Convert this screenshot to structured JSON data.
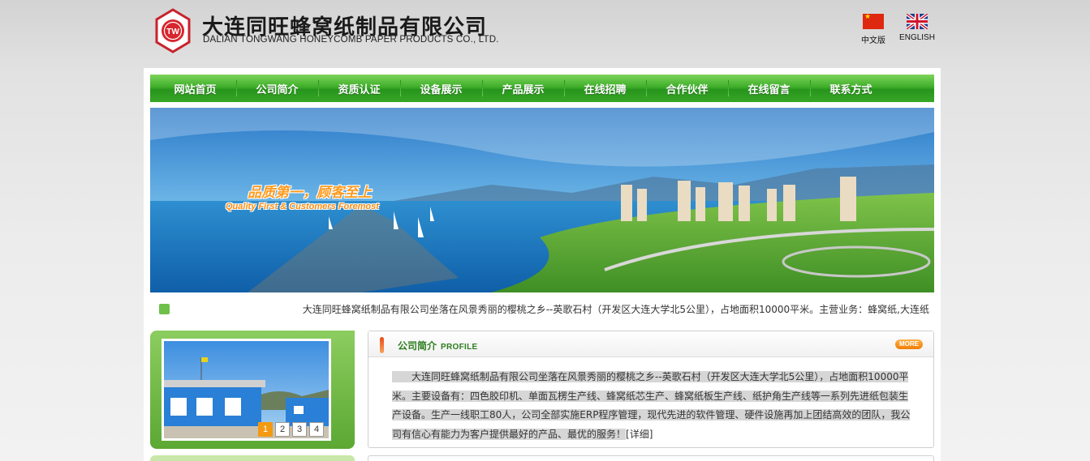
{
  "header": {
    "logo_badge_text": "TW",
    "company_name_cn": "大连同旺蜂窝纸制品有限公司",
    "company_name_en": "DALIAN TONGWANG HONEYCOMB PAPER PRODUCTS CO., LTD.",
    "languages": [
      {
        "label": "中文版",
        "icon": "china-flag-icon"
      },
      {
        "label": "ENGLISH",
        "icon": "uk-flag-icon"
      }
    ]
  },
  "nav": {
    "items": [
      "网站首页",
      "公司简介",
      "资质认证",
      "设备展示",
      "产品展示",
      "在线招聘",
      "合作伙伴",
      "在线留言",
      "联系方式"
    ]
  },
  "banner": {
    "slogan_cn": "品质第一，顾客至上",
    "slogan_en": "Quality First & Customers Foremost"
  },
  "marquee": {
    "icon": "speaker-icon",
    "text": "大连同旺蜂窝纸制品有限公司坐落在风景秀丽的樱桃之乡--英歌石村（开发区大连大学北5公里），占地面积10000平米。主营业务：蜂窝纸,大连纸"
  },
  "photo_slider": {
    "pages": [
      "1",
      "2",
      "3",
      "4"
    ],
    "active_page": "1"
  },
  "profile": {
    "title": "公司简介",
    "subtitle": "PROFILE",
    "more_label": "MORE",
    "body": "大连同旺蜂窝纸制品有限公司坐落在风景秀丽的樱桃之乡--英歌石村（开发区大连大学北5公里），占地面积10000平米。主要设备有：四色胶印机、单面瓦楞生产线、蜂窝纸芯生产、蜂窝纸板生产线、纸护角生产线等一系列先进纸包装生产设备。生产一线职工80人，公司全部实施ERP程序管理，现代先进的软件管理、硬件设施再加上团结高效的团队，我公司有信心有能力为客户提供最好的产品、最优的服务！",
    "detail_link": "[详细]"
  },
  "colors": {
    "nav_green": "#3fae2a",
    "title_green": "#2d7d1e",
    "accent_orange": "#f39a12"
  }
}
